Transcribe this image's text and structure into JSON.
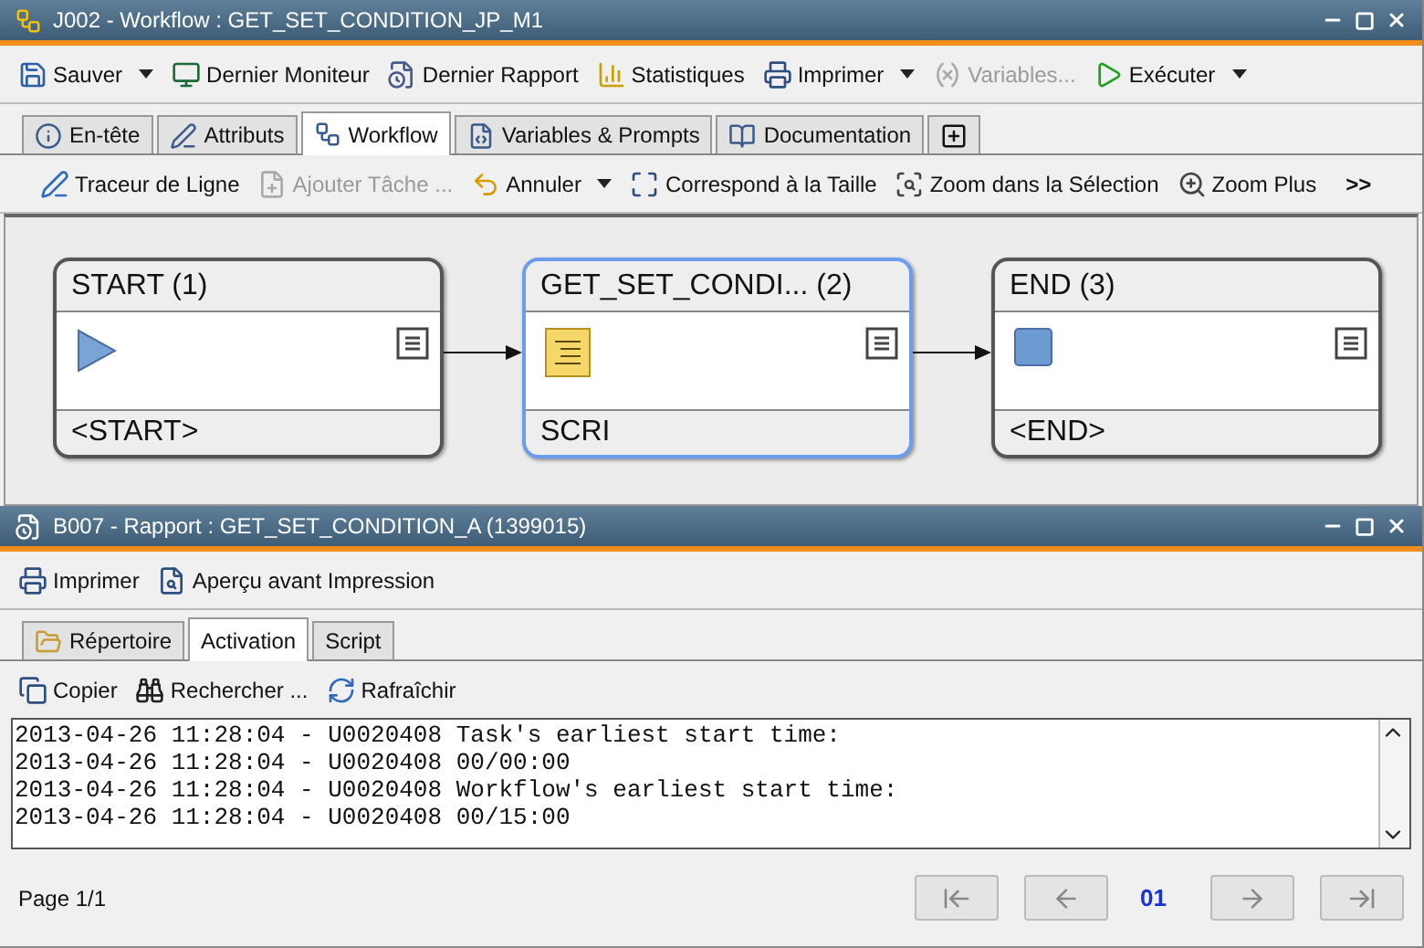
{
  "workflow_window": {
    "title": "J002 - Workflow : GET_SET_CONDITION_JP_M1",
    "toolbar": [
      {
        "label": "Sauver",
        "kind": "dropdown",
        "disabled": false
      },
      {
        "label": "Dernier Moniteur",
        "kind": "button",
        "disabled": false
      },
      {
        "label": "Dernier Rapport",
        "kind": "button",
        "disabled": false
      },
      {
        "label": "Statistiques",
        "kind": "button",
        "disabled": false
      },
      {
        "label": "Imprimer",
        "kind": "dropdown",
        "disabled": false
      },
      {
        "label": "Variables...",
        "kind": "button",
        "disabled": true
      },
      {
        "label": "Exécuter",
        "kind": "dropdown",
        "disabled": false
      }
    ],
    "tabs": [
      {
        "label": "En-tête",
        "selected": false
      },
      {
        "label": "Attributs",
        "selected": false
      },
      {
        "label": "Workflow",
        "selected": true
      },
      {
        "label": "Variables & Prompts",
        "selected": false
      },
      {
        "label": "Documentation",
        "selected": false
      }
    ],
    "canvas_toolbar": [
      {
        "label": "Traceur de Ligne",
        "kind": "button",
        "disabled": false
      },
      {
        "label": "Ajouter Tâche ...",
        "kind": "button",
        "disabled": true
      },
      {
        "label": "Annuler",
        "kind": "dropdown",
        "disabled": false
      },
      {
        "label": "Correspond à la Taille",
        "kind": "button",
        "disabled": false
      },
      {
        "label": "Zoom dans la Sélection",
        "kind": "button",
        "disabled": false
      },
      {
        "label": "Zoom Plus",
        "kind": "button",
        "disabled": false
      },
      {
        "label": ">>",
        "kind": "overflow",
        "disabled": false
      }
    ],
    "nodes": [
      {
        "title": "START (1)",
        "type": "<START>",
        "kind": "start",
        "selected": false
      },
      {
        "title": "GET_SET_CONDI... (2)",
        "type": "SCRI",
        "kind": "script",
        "selected": true
      },
      {
        "title": "END (3)",
        "type": "<END>",
        "kind": "end",
        "selected": false
      }
    ]
  },
  "report_window": {
    "title": "B007 - Rapport : GET_SET_CONDITION_A (1399015)",
    "toolbar": [
      {
        "label": "Imprimer",
        "disabled": false
      },
      {
        "label": "Aperçu avant Impression",
        "disabled": false
      }
    ],
    "tabs": [
      {
        "label": "Répertoire",
        "selected": false
      },
      {
        "label": "Activation",
        "selected": true
      },
      {
        "label": "Script",
        "selected": false
      }
    ],
    "log_toolbar": [
      {
        "label": "Copier",
        "disabled": false
      },
      {
        "label": "Rechercher ...",
        "disabled": false
      },
      {
        "label": "Rafraîchir",
        "disabled": false
      }
    ],
    "log_lines": [
      "2013-04-26 11:28:04 - U0020408 Task's earliest start time:",
      "2013-04-26 11:28:04 - U0020408 00/00:00",
      "2013-04-26 11:28:04 - U0020408 Workflow's earliest start time:",
      "2013-04-26 11:28:04 - U0020408 00/15:00"
    ],
    "page_label": "Page 1/1",
    "page_number": "01"
  }
}
